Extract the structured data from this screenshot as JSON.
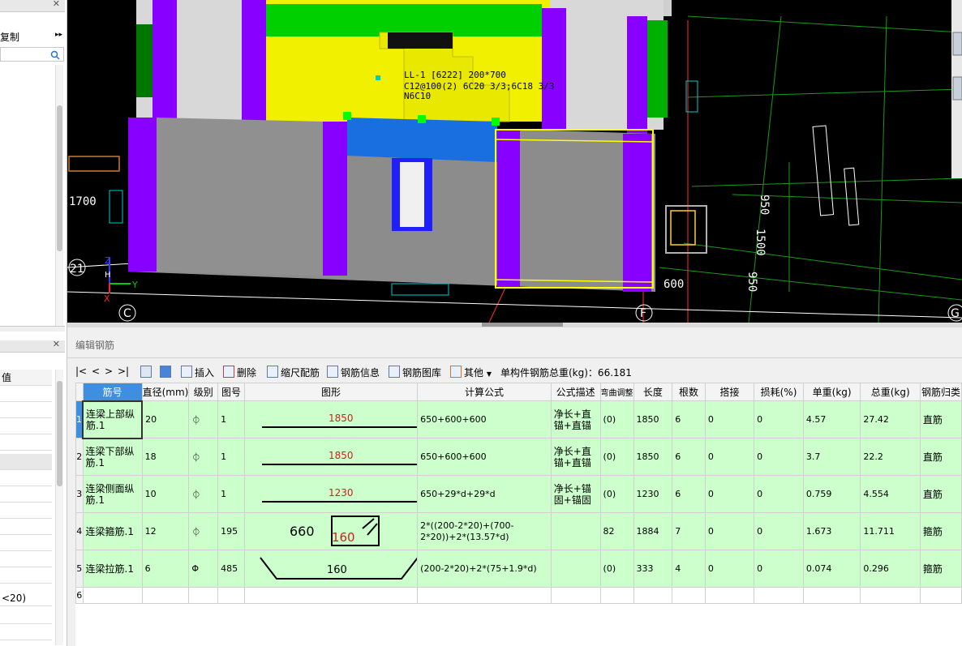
{
  "left_panel": {
    "copy_label": "复制",
    "expand_glyph": "▸▸",
    "close_glyph": "✕",
    "prop_column_fragment": "值",
    "condition_fragment": "<20)"
  },
  "viewport": {
    "beam_label_line1": "LL-1 [6222] 200*700",
    "beam_label_line2": "C12@100(2) 6C20 3/3;6C18 3/3",
    "beam_label_line3": "N6C10",
    "dim_1700": "1700",
    "axis_21": "21",
    "axis_C": "C",
    "axis_F": "F",
    "axis_G": "G",
    "dim_950a": "950",
    "dim_1500": "1500",
    "dim_950b": "950",
    "dim_600": "600",
    "axis_z": "Z",
    "axis_y": "Y",
    "axis_x": "X",
    "axis_h": "H"
  },
  "editor": {
    "title": "编辑钢筋",
    "toolbar": {
      "nav_first": "|<",
      "nav_prev": "<",
      "nav_next": ">",
      "nav_last": ">|",
      "insert": "插入",
      "delete": "删除",
      "scale_rebar": "缩尺配筋",
      "rebar_info": "钢筋信息",
      "rebar_library": "钢筋图库",
      "other": "其他",
      "total_weight_label": "单构件钢筋总重(kg)：66.181"
    },
    "columns": [
      "筋号",
      "直径(mm)",
      "级别",
      "图号",
      "图形",
      "计算公式",
      "公式描述",
      "弯曲调整",
      "长度",
      "根数",
      "搭接",
      "损耗(%)",
      "单重(kg)",
      "总重(kg)",
      "钢筋归类"
    ],
    "rows": [
      {
        "idx": "1",
        "name": "连梁上部纵筋.1",
        "dia": "20",
        "grade": "⏀",
        "fig": "1",
        "shape_val": "1850",
        "formula": "650+600+600",
        "desc": "净长+直锚+直锚",
        "bend": "(0)",
        "length": "1850",
        "count": "6",
        "lap": "0",
        "loss": "0",
        "unit": "4.57",
        "total": "27.42",
        "cls": "直筋"
      },
      {
        "idx": "2",
        "name": "连梁下部纵筋.1",
        "dia": "18",
        "grade": "⏀",
        "fig": "1",
        "shape_val": "1850",
        "formula": "650+600+600",
        "desc": "净长+直锚+直锚",
        "bend": "(0)",
        "length": "1850",
        "count": "6",
        "lap": "0",
        "loss": "0",
        "unit": "3.7",
        "total": "22.2",
        "cls": "直筋"
      },
      {
        "idx": "3",
        "name": "连梁侧面纵筋.1",
        "dia": "10",
        "grade": "⏀",
        "fig": "1",
        "shape_val": "1230",
        "formula": "650+29*d+29*d",
        "desc": "净长+锚固+锚固",
        "bend": "(0)",
        "length": "1230",
        "count": "6",
        "lap": "0",
        "loss": "0",
        "unit": "0.759",
        "total": "4.554",
        "cls": "直筋"
      },
      {
        "idx": "4",
        "name": "连梁箍筋.1",
        "dia": "12",
        "grade": "⏀",
        "fig": "195",
        "shape_a": "660",
        "shape_b": "160",
        "formula": "2*((200-2*20)+(700-2*20))+2*(13.57*d)",
        "desc": "",
        "bend": "82",
        "length": "1884",
        "count": "7",
        "lap": "0",
        "loss": "0",
        "unit": "1.673",
        "total": "11.711",
        "cls": "箍筋"
      },
      {
        "idx": "5",
        "name": "连梁拉筋.1",
        "dia": "6",
        "grade": "Φ",
        "fig": "485",
        "shape_val": "160",
        "formula": "(200-2*20)+2*(75+1.9*d)",
        "desc": "",
        "bend": "(0)",
        "length": "333",
        "count": "4",
        "lap": "0",
        "loss": "0",
        "unit": "0.074",
        "total": "0.296",
        "cls": "箍筋"
      }
    ],
    "empty_row_idx": "6"
  }
}
